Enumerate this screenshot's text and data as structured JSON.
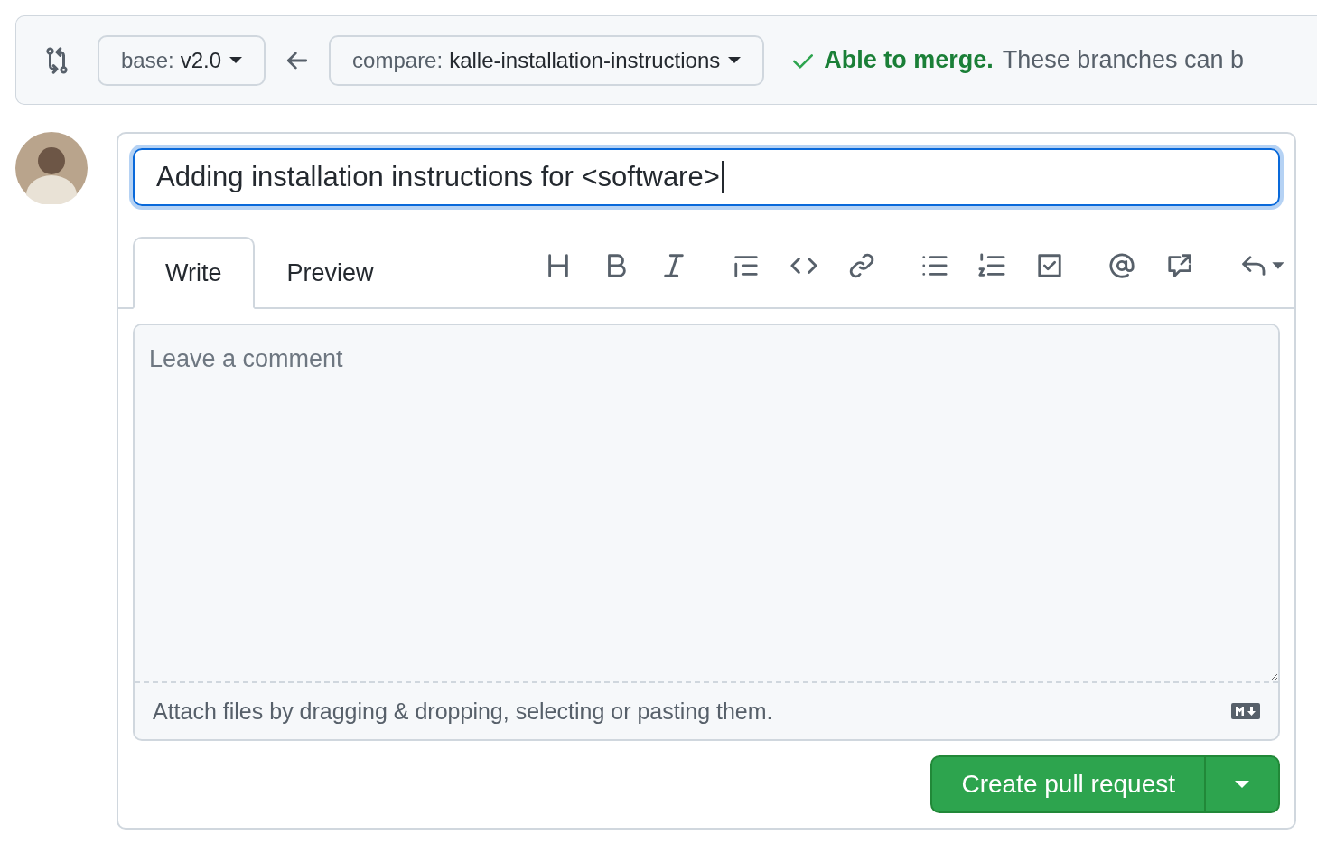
{
  "header": {
    "base": {
      "label": "base:",
      "branch": "v2.0"
    },
    "compare": {
      "label": "compare:",
      "branch": "kalle-installation-instructions"
    },
    "merge_status": {
      "ok": true,
      "title": "Able to merge.",
      "message": "These branches can b"
    }
  },
  "title_field": {
    "value": "Adding installation instructions for <software>",
    "focused": true
  },
  "tabs": [
    {
      "label": "Write",
      "selected": true
    },
    {
      "label": "Preview",
      "selected": false
    }
  ],
  "comment": {
    "placeholder": "Leave a comment"
  },
  "attach_hint": "Attach files by dragging & dropping, selecting or pasting them.",
  "submit": {
    "label": "Create pull request"
  }
}
